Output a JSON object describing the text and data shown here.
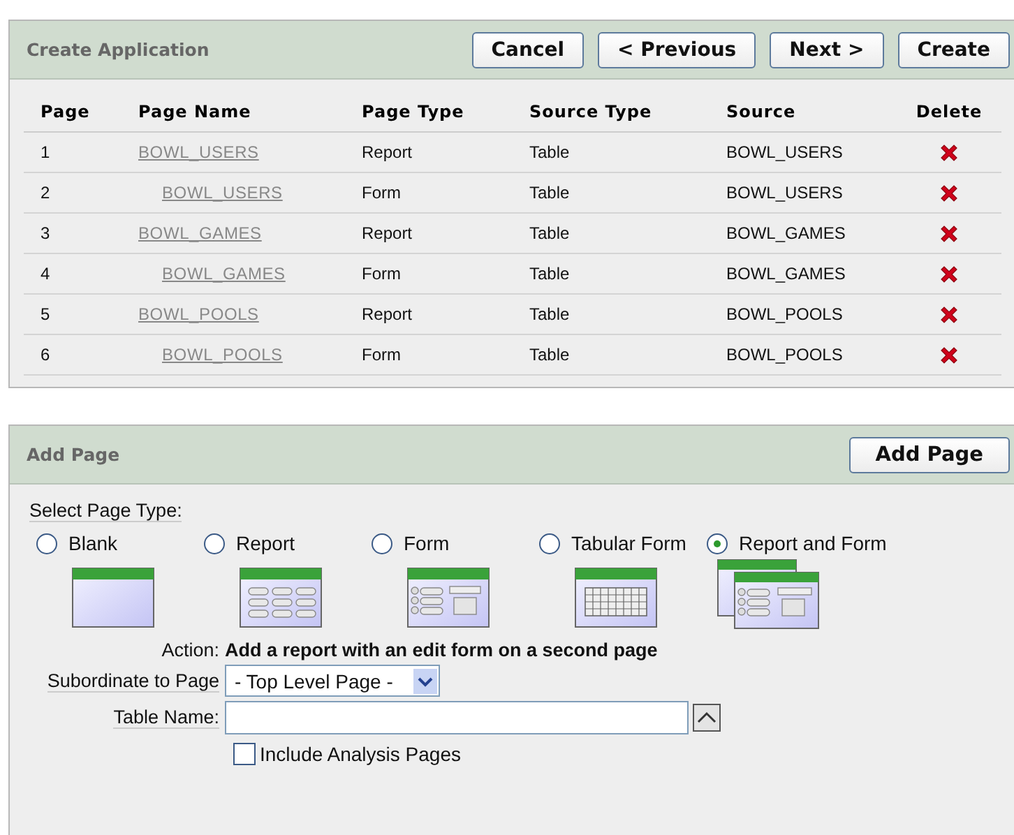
{
  "create_panel": {
    "title": "Create Application",
    "buttons": [
      "Cancel",
      "< Previous",
      "Next >",
      "Create"
    ]
  },
  "table": {
    "columns": [
      "Page",
      "Page Name",
      "Page Type",
      "Source Type",
      "Source",
      "Delete"
    ],
    "rows": [
      {
        "page": "1",
        "name": "BOWL_USERS",
        "page_type": "Report",
        "source_type": "Table",
        "source": "BOWL_USERS",
        "children": [
          {
            "page": "2",
            "name": "BOWL_USERS",
            "page_type": "Form",
            "source_type": "Table",
            "source": "BOWL_USERS"
          }
        ]
      },
      {
        "page": "3",
        "name": "BOWL_GAMES",
        "page_type": "Report",
        "source_type": "Table",
        "source": "BOWL_GAMES",
        "children": [
          {
            "page": "4",
            "name": "BOWL_GAMES",
            "page_type": "Form",
            "source_type": "Table",
            "source": "BOWL_GAMES"
          }
        ]
      },
      {
        "page": "5",
        "name": "BOWL_POOLS",
        "page_type": "Report",
        "source_type": "Table",
        "source": "BOWL_POOLS",
        "children": [
          {
            "page": "6",
            "name": "BOWL_POOLS",
            "page_type": "Form",
            "source_type": "Table",
            "source": "BOWL_POOLS"
          }
        ]
      }
    ]
  },
  "add_panel": {
    "title": "Add Page",
    "button": "Add Page",
    "page_type_label": "Select Page Type:",
    "page_types": [
      {
        "label": "Blank",
        "kind": "blank",
        "selected": false
      },
      {
        "label": "Report",
        "kind": "report",
        "selected": false
      },
      {
        "label": "Form",
        "kind": "form",
        "selected": false
      },
      {
        "label": "Tabular Form",
        "kind": "tabular",
        "selected": false
      },
      {
        "label": "Report and Form",
        "kind": "report_form",
        "selected": true
      }
    ],
    "action_label": "Action:",
    "action": "Add a report with an edit form on a second page",
    "subordinate_label": "Subordinate to Page",
    "subordinate_value": "- Top Level Page -",
    "table_name_label": "Table Name:",
    "include_analysis": {
      "label": "Include Analysis Pages",
      "checked": false
    }
  }
}
